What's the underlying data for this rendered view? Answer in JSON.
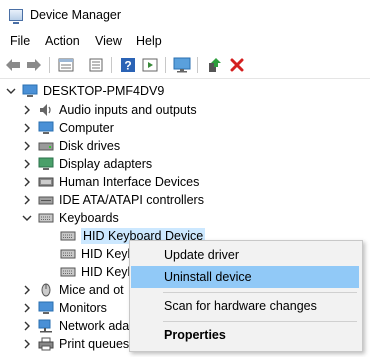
{
  "window": {
    "title": "Device Manager"
  },
  "menu": [
    "File",
    "Action",
    "View",
    "Help"
  ],
  "toolbar": {
    "buttons": [
      "back-arrow-icon",
      "forward-arrow-icon",
      "properties-grid-icon",
      "device-view-icon",
      "help-icon",
      "run-icon",
      "monitor-scan-icon",
      "enable-device-icon",
      "uninstall-x-icon"
    ]
  },
  "tree": {
    "root": "DESKTOP-PMF4DV9",
    "categories": [
      "Audio inputs and outputs",
      "Computer",
      "Disk drives",
      "Display adapters",
      "Human Interface Devices",
      "IDE ATA/ATAPI controllers",
      "Keyboards",
      "Mice and ot",
      "Monitors",
      "Network ada",
      "Print queues"
    ],
    "keyboard_children": [
      "HID Keyboard Device",
      "HID Keyb",
      "HID Keyb"
    ]
  },
  "context_menu": {
    "items": [
      "Update driver",
      "Uninstall device",
      "Scan for hardware changes",
      "Properties"
    ],
    "highlighted": "Uninstall device"
  },
  "colors": {
    "selection": "#cce8ff",
    "menu_highlight": "#91c9f7",
    "accent": "#2a6fb0",
    "uninstall_red": "#d42020",
    "enable_green": "#2e9e3e"
  }
}
